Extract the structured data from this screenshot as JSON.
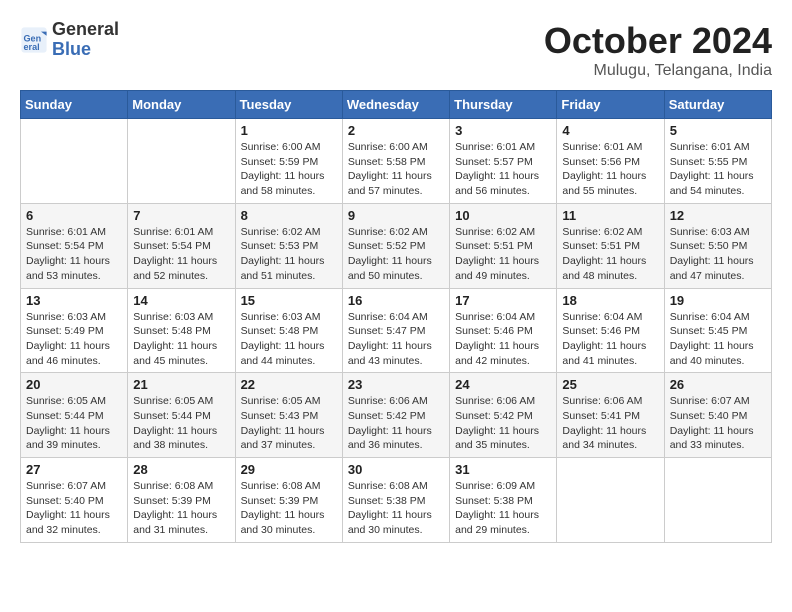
{
  "logo": {
    "line1": "General",
    "line2": "Blue"
  },
  "title": "October 2024",
  "location": "Mulugu, Telangana, India",
  "days_of_week": [
    "Sunday",
    "Monday",
    "Tuesday",
    "Wednesday",
    "Thursday",
    "Friday",
    "Saturday"
  ],
  "weeks": [
    [
      {
        "day": "",
        "sunrise": "",
        "sunset": "",
        "daylight": ""
      },
      {
        "day": "",
        "sunrise": "",
        "sunset": "",
        "daylight": ""
      },
      {
        "day": "1",
        "sunrise": "Sunrise: 6:00 AM",
        "sunset": "Sunset: 5:59 PM",
        "daylight": "Daylight: 11 hours and 58 minutes."
      },
      {
        "day": "2",
        "sunrise": "Sunrise: 6:00 AM",
        "sunset": "Sunset: 5:58 PM",
        "daylight": "Daylight: 11 hours and 57 minutes."
      },
      {
        "day": "3",
        "sunrise": "Sunrise: 6:01 AM",
        "sunset": "Sunset: 5:57 PM",
        "daylight": "Daylight: 11 hours and 56 minutes."
      },
      {
        "day": "4",
        "sunrise": "Sunrise: 6:01 AM",
        "sunset": "Sunset: 5:56 PM",
        "daylight": "Daylight: 11 hours and 55 minutes."
      },
      {
        "day": "5",
        "sunrise": "Sunrise: 6:01 AM",
        "sunset": "Sunset: 5:55 PM",
        "daylight": "Daylight: 11 hours and 54 minutes."
      }
    ],
    [
      {
        "day": "6",
        "sunrise": "Sunrise: 6:01 AM",
        "sunset": "Sunset: 5:54 PM",
        "daylight": "Daylight: 11 hours and 53 minutes."
      },
      {
        "day": "7",
        "sunrise": "Sunrise: 6:01 AM",
        "sunset": "Sunset: 5:54 PM",
        "daylight": "Daylight: 11 hours and 52 minutes."
      },
      {
        "day": "8",
        "sunrise": "Sunrise: 6:02 AM",
        "sunset": "Sunset: 5:53 PM",
        "daylight": "Daylight: 11 hours and 51 minutes."
      },
      {
        "day": "9",
        "sunrise": "Sunrise: 6:02 AM",
        "sunset": "Sunset: 5:52 PM",
        "daylight": "Daylight: 11 hours and 50 minutes."
      },
      {
        "day": "10",
        "sunrise": "Sunrise: 6:02 AM",
        "sunset": "Sunset: 5:51 PM",
        "daylight": "Daylight: 11 hours and 49 minutes."
      },
      {
        "day": "11",
        "sunrise": "Sunrise: 6:02 AM",
        "sunset": "Sunset: 5:51 PM",
        "daylight": "Daylight: 11 hours and 48 minutes."
      },
      {
        "day": "12",
        "sunrise": "Sunrise: 6:03 AM",
        "sunset": "Sunset: 5:50 PM",
        "daylight": "Daylight: 11 hours and 47 minutes."
      }
    ],
    [
      {
        "day": "13",
        "sunrise": "Sunrise: 6:03 AM",
        "sunset": "Sunset: 5:49 PM",
        "daylight": "Daylight: 11 hours and 46 minutes."
      },
      {
        "day": "14",
        "sunrise": "Sunrise: 6:03 AM",
        "sunset": "Sunset: 5:48 PM",
        "daylight": "Daylight: 11 hours and 45 minutes."
      },
      {
        "day": "15",
        "sunrise": "Sunrise: 6:03 AM",
        "sunset": "Sunset: 5:48 PM",
        "daylight": "Daylight: 11 hours and 44 minutes."
      },
      {
        "day": "16",
        "sunrise": "Sunrise: 6:04 AM",
        "sunset": "Sunset: 5:47 PM",
        "daylight": "Daylight: 11 hours and 43 minutes."
      },
      {
        "day": "17",
        "sunrise": "Sunrise: 6:04 AM",
        "sunset": "Sunset: 5:46 PM",
        "daylight": "Daylight: 11 hours and 42 minutes."
      },
      {
        "day": "18",
        "sunrise": "Sunrise: 6:04 AM",
        "sunset": "Sunset: 5:46 PM",
        "daylight": "Daylight: 11 hours and 41 minutes."
      },
      {
        "day": "19",
        "sunrise": "Sunrise: 6:04 AM",
        "sunset": "Sunset: 5:45 PM",
        "daylight": "Daylight: 11 hours and 40 minutes."
      }
    ],
    [
      {
        "day": "20",
        "sunrise": "Sunrise: 6:05 AM",
        "sunset": "Sunset: 5:44 PM",
        "daylight": "Daylight: 11 hours and 39 minutes."
      },
      {
        "day": "21",
        "sunrise": "Sunrise: 6:05 AM",
        "sunset": "Sunset: 5:44 PM",
        "daylight": "Daylight: 11 hours and 38 minutes."
      },
      {
        "day": "22",
        "sunrise": "Sunrise: 6:05 AM",
        "sunset": "Sunset: 5:43 PM",
        "daylight": "Daylight: 11 hours and 37 minutes."
      },
      {
        "day": "23",
        "sunrise": "Sunrise: 6:06 AM",
        "sunset": "Sunset: 5:42 PM",
        "daylight": "Daylight: 11 hours and 36 minutes."
      },
      {
        "day": "24",
        "sunrise": "Sunrise: 6:06 AM",
        "sunset": "Sunset: 5:42 PM",
        "daylight": "Daylight: 11 hours and 35 minutes."
      },
      {
        "day": "25",
        "sunrise": "Sunrise: 6:06 AM",
        "sunset": "Sunset: 5:41 PM",
        "daylight": "Daylight: 11 hours and 34 minutes."
      },
      {
        "day": "26",
        "sunrise": "Sunrise: 6:07 AM",
        "sunset": "Sunset: 5:40 PM",
        "daylight": "Daylight: 11 hours and 33 minutes."
      }
    ],
    [
      {
        "day": "27",
        "sunrise": "Sunrise: 6:07 AM",
        "sunset": "Sunset: 5:40 PM",
        "daylight": "Daylight: 11 hours and 32 minutes."
      },
      {
        "day": "28",
        "sunrise": "Sunrise: 6:08 AM",
        "sunset": "Sunset: 5:39 PM",
        "daylight": "Daylight: 11 hours and 31 minutes."
      },
      {
        "day": "29",
        "sunrise": "Sunrise: 6:08 AM",
        "sunset": "Sunset: 5:39 PM",
        "daylight": "Daylight: 11 hours and 30 minutes."
      },
      {
        "day": "30",
        "sunrise": "Sunrise: 6:08 AM",
        "sunset": "Sunset: 5:38 PM",
        "daylight": "Daylight: 11 hours and 30 minutes."
      },
      {
        "day": "31",
        "sunrise": "Sunrise: 6:09 AM",
        "sunset": "Sunset: 5:38 PM",
        "daylight": "Daylight: 11 hours and 29 minutes."
      },
      {
        "day": "",
        "sunrise": "",
        "sunset": "",
        "daylight": ""
      },
      {
        "day": "",
        "sunrise": "",
        "sunset": "",
        "daylight": ""
      }
    ]
  ]
}
